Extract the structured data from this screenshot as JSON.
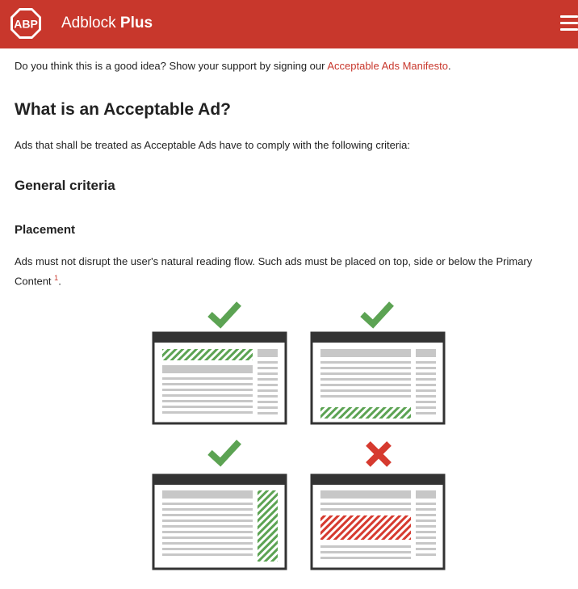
{
  "header": {
    "logo_text": "ABP",
    "brand_first": "Adblock",
    "brand_second": "Plus",
    "menu_icon": "hamburger-icon"
  },
  "intro": {
    "text_before": "Do you think this is a good idea? Show your support by signing our",
    "link_text": "Acceptable Ads Manifesto",
    "text_after": "."
  },
  "heading_main": "What is an Acceptable Ad?",
  "criteria_intro": "Ads that shall be treated as Acceptable Ads have to comply with the following criteria:",
  "heading_general": "General criteria",
  "heading_placement": "Placement",
  "placement_text": "Ads must not disrupt the user's natural reading flow. Such ads must be placed on top, side or below the Primary Content",
  "footnote_ref": "1",
  "placement_text_end": ".",
  "diagram": {
    "panels": [
      {
        "verdict": "check-icon",
        "ad_position": "top"
      },
      {
        "verdict": "check-icon",
        "ad_position": "bottom"
      },
      {
        "verdict": "check-icon",
        "ad_position": "side"
      },
      {
        "verdict": "cross-icon",
        "ad_position": "in-content"
      }
    ],
    "colors": {
      "accept": "#5ca353",
      "reject": "#d63a2f",
      "frame": "#333333",
      "content": "#c7c7c7"
    }
  }
}
